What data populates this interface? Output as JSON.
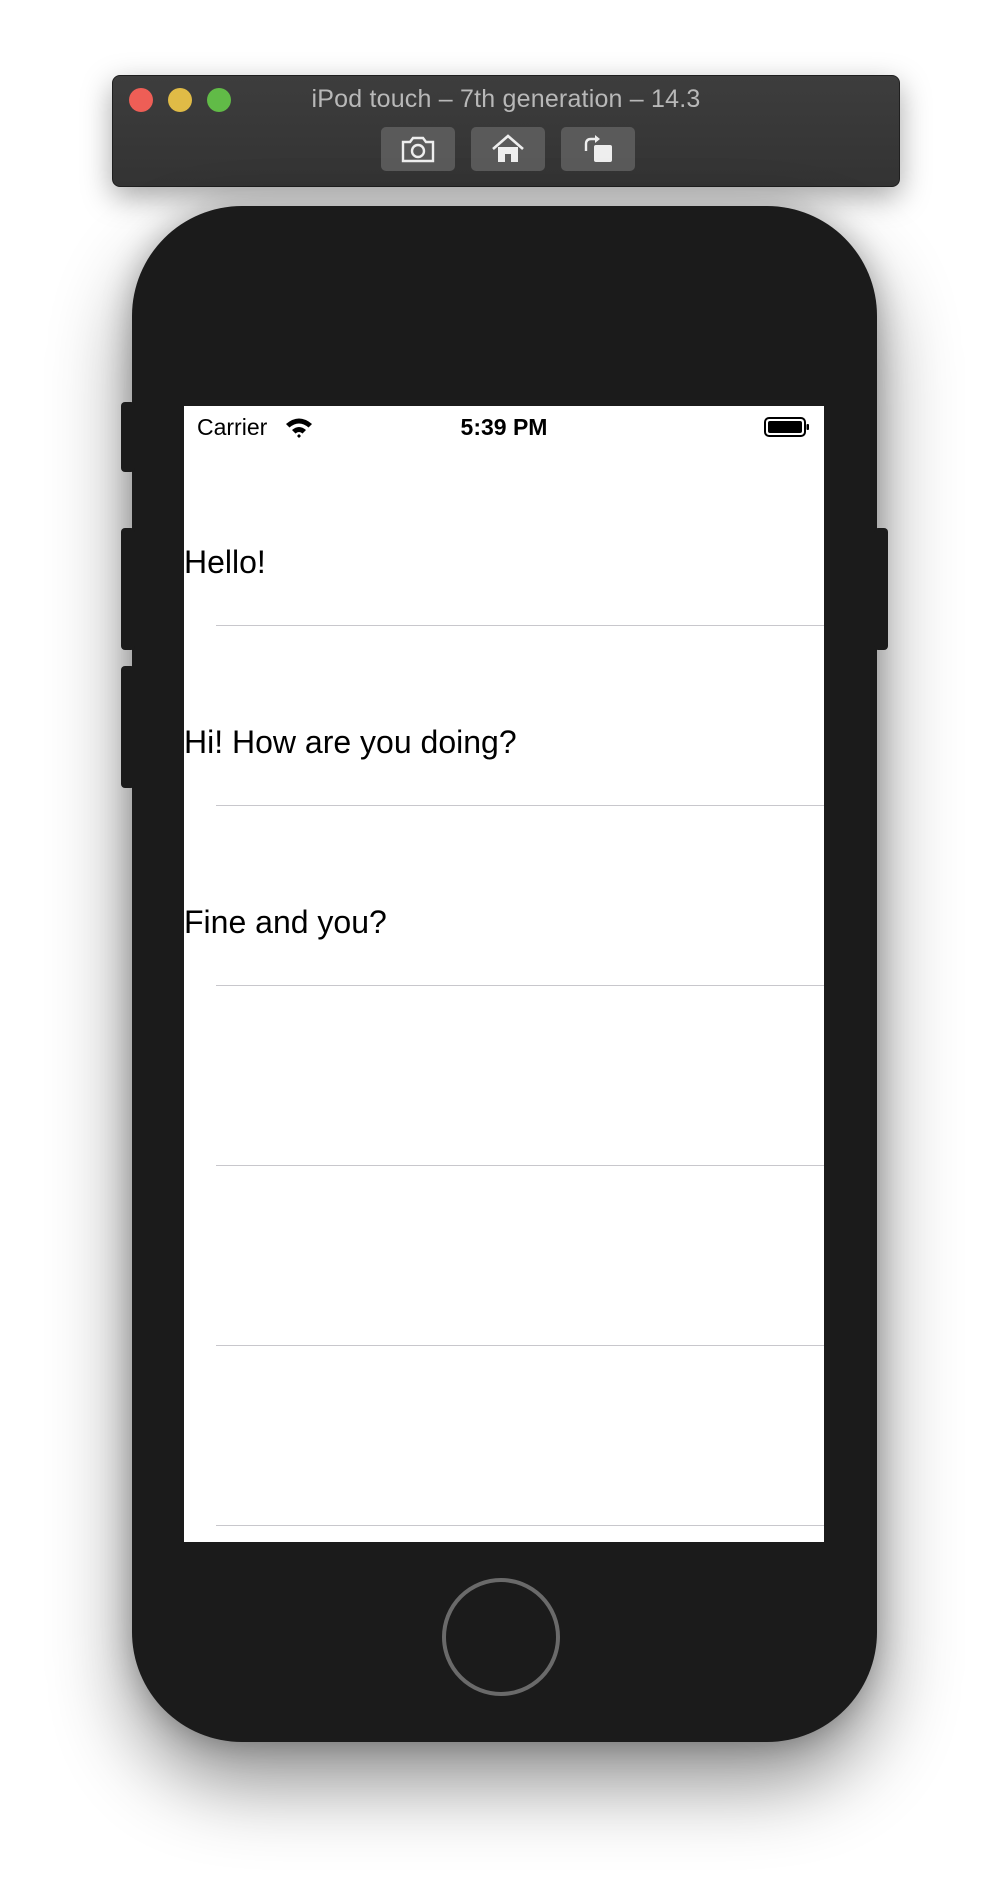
{
  "simulator": {
    "title": "iPod touch – 7th generation – 14.3",
    "buttons": [
      {
        "icon": "camera-icon",
        "label": "Screenshot"
      },
      {
        "icon": "home-icon",
        "label": "Home"
      },
      {
        "icon": "rotate-icon",
        "label": "Rotate"
      }
    ]
  },
  "status_bar": {
    "carrier": "Carrier",
    "time": "5:39 PM"
  },
  "table": {
    "rows": [
      {
        "text": "Hello!"
      },
      {
        "text": "Hi! How are you doing?"
      },
      {
        "text": "Fine and you?"
      },
      {
        "text": ""
      },
      {
        "text": ""
      },
      {
        "text": ""
      }
    ]
  },
  "colors": {
    "title_bar": "#3a3a3a",
    "device_body": "#1b1b1b",
    "separator": "#c8c7cc",
    "traffic_red": "#ee5e56",
    "traffic_yellow": "#e0bb46",
    "traffic_green": "#61bb47"
  }
}
